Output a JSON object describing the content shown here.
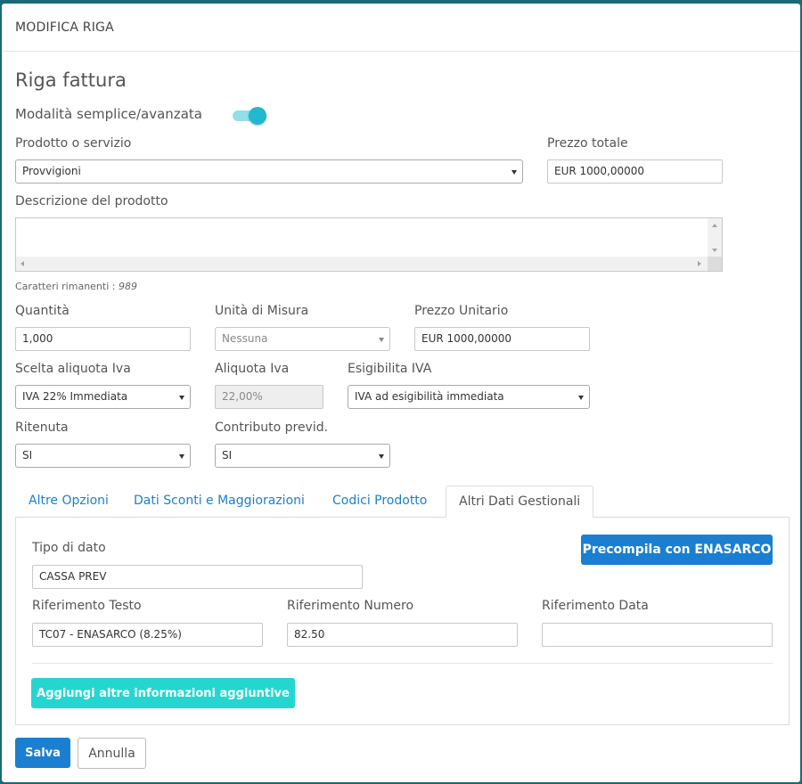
{
  "modal": {
    "title": "MODIFICA RIGA"
  },
  "form": {
    "heading": "Riga fattura",
    "mode_toggle": {
      "label": "Modalità semplice/avanzata",
      "on": true
    },
    "product": {
      "label": "Prodotto o servizio",
      "value": "Provvigioni"
    },
    "total_price": {
      "label": "Prezzo totale",
      "value": "EUR 1000,00000"
    },
    "description": {
      "label": "Descrizione del prodotto",
      "value": ""
    },
    "remaining": {
      "prefix": "Caratteri rimanenti :",
      "count": "989"
    },
    "quantity": {
      "label": "Quantità",
      "value": "1,000"
    },
    "unit": {
      "label": "Unità di Misura",
      "value": "Nessuna"
    },
    "unit_price": {
      "label": "Prezzo Unitario",
      "value": "EUR 1000,00000"
    },
    "vat_choice": {
      "label": "Scelta aliquota Iva",
      "value": "IVA 22% Immediata"
    },
    "vat_rate": {
      "label": "Aliquota Iva",
      "value": "22,00%"
    },
    "vat_exigibility": {
      "label": "Esigibilita IVA",
      "value": "IVA ad esigibilità immediata"
    },
    "withholding": {
      "label": "Ritenuta",
      "value": "SI"
    },
    "social_contribution": {
      "label": "Contributo previd.",
      "value": "SI"
    }
  },
  "tabs": [
    {
      "label": "Altre Opzioni",
      "active": false
    },
    {
      "label": "Dati Sconti e Maggiorazioni",
      "active": false
    },
    {
      "label": "Codici Prodotto",
      "active": false
    },
    {
      "label": "Altri Dati Gestionali",
      "active": true
    }
  ],
  "panel": {
    "data_type": {
      "label": "Tipo di dato",
      "value": "CASSA PREV"
    },
    "prefill_button": "Precompila con ENASARCO",
    "ref_text": {
      "label": "Riferimento Testo",
      "value": "TC07 - ENASARCO (8.25%)"
    },
    "ref_number": {
      "label": "Riferimento Numero",
      "value": "82.50"
    },
    "ref_date": {
      "label": "Riferimento Data",
      "value": ""
    },
    "add_info_button": "Aggiungi altre informazioni aggiuntive"
  },
  "footer": {
    "save": "Salva",
    "cancel": "Annulla"
  },
  "colors": {
    "primary": "#1b7fd1",
    "cyan": "#25d6d0",
    "toggle": "#22b8cf",
    "backdrop": "#1a6b73"
  }
}
